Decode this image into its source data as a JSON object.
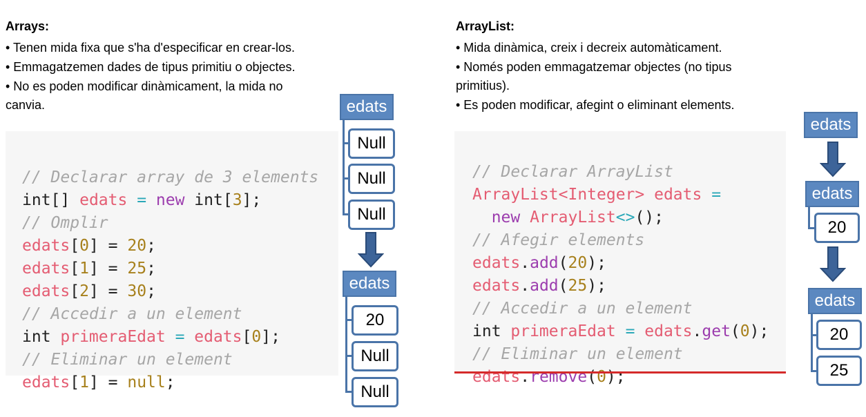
{
  "left": {
    "heading": "Arrays:",
    "bullets": [
      "• Tenen mida fixa que s'ha d'especificar en crear-los.",
      "• Emmagatzemen dades de tipus primitiu o objectes.",
      "• No es poden modificar dinàmicament, la mida no",
      "canvia."
    ],
    "code": {
      "l1": "// Declarar array de 3 elements",
      "l2a": "int[] ",
      "l2b": "edats",
      "l2c": " = ",
      "l2d": "new",
      "l2e": " int[",
      "l2f": "3",
      "l2g": "];",
      "l3": "// Omplir",
      "l4a": "edats",
      "l4b": "[",
      "l4c": "0",
      "l4d": "] = ",
      "l4e": "20",
      "l4f": ";",
      "l5a": "edats",
      "l5b": "[",
      "l5c": "1",
      "l5d": "] = ",
      "l5e": "25",
      "l5f": ";",
      "l6a": "edats",
      "l6b": "[",
      "l6c": "2",
      "l6d": "] = ",
      "l6e": "30",
      "l6f": ";",
      "l7": "// Accedir a un element",
      "l8a": "int ",
      "l8b": "primeraEdat",
      "l8c": " = ",
      "l8d": "edats",
      "l8e": "[",
      "l8f": "0",
      "l8g": "];",
      "l9": "// Eliminar un element",
      "l10a": "edats",
      "l10b": "[",
      "l10c": "1",
      "l10d": "] = ",
      "l10e": "null",
      "l10f": ";"
    },
    "diagram1": {
      "header": "edats",
      "cells": [
        "Null",
        "Null",
        "Null"
      ]
    },
    "diagram2": {
      "header": "edats",
      "cells": [
        "20",
        "Null",
        "Null"
      ]
    }
  },
  "right": {
    "heading": "ArrayList:",
    "bullets": [
      "• Mida dinàmica, creix i decreix automàticament.",
      "• Només poden emmagatzemar objectes (no tipus",
      "primitius).",
      "• Es poden modificar, afegint o eliminant elements."
    ],
    "code": {
      "l1": "// Declarar ArrayList",
      "l2a": "ArrayList",
      "l2b": "<Integer>",
      "l2c": " edats",
      "l2d": " =",
      "l3a": "  new",
      "l3b": " ArrayList",
      "l3c": "<>",
      "l3d": "();",
      "l4": "// Afegir elements",
      "l5a": "edats",
      "l5b": ".",
      "l5c": "add",
      "l5d": "(",
      "l5e": "20",
      "l5f": ");",
      "l6a": "edats",
      "l6b": ".",
      "l6c": "add",
      "l6d": "(",
      "l6e": "25",
      "l6f": ");",
      "l7": "// Accedir a un element",
      "l8a": "int ",
      "l8b": "primeraEdat",
      "l8c": " = ",
      "l8d": "edats",
      "l8e": ".",
      "l8f": "get",
      "l8g": "(",
      "l8h": "0",
      "l8i": ");",
      "l9": "// Eliminar un element",
      "l10a": "edats",
      "l10b": ".",
      "l10c": "remove",
      "l10d": "(",
      "l10e": "0",
      "l10f": ");"
    },
    "diagram1": {
      "header": "edats"
    },
    "diagram2": {
      "header": "edats",
      "cells": [
        "20"
      ]
    },
    "diagram3": {
      "header": "edats",
      "cells": [
        "20",
        "25"
      ]
    }
  },
  "colors": {
    "box_blue": "#5b88c0",
    "border_blue": "#4a74a8",
    "variable_red": "#e45c72",
    "keyword_purple": "#9c3dae",
    "number_gold": "#a7801c"
  }
}
